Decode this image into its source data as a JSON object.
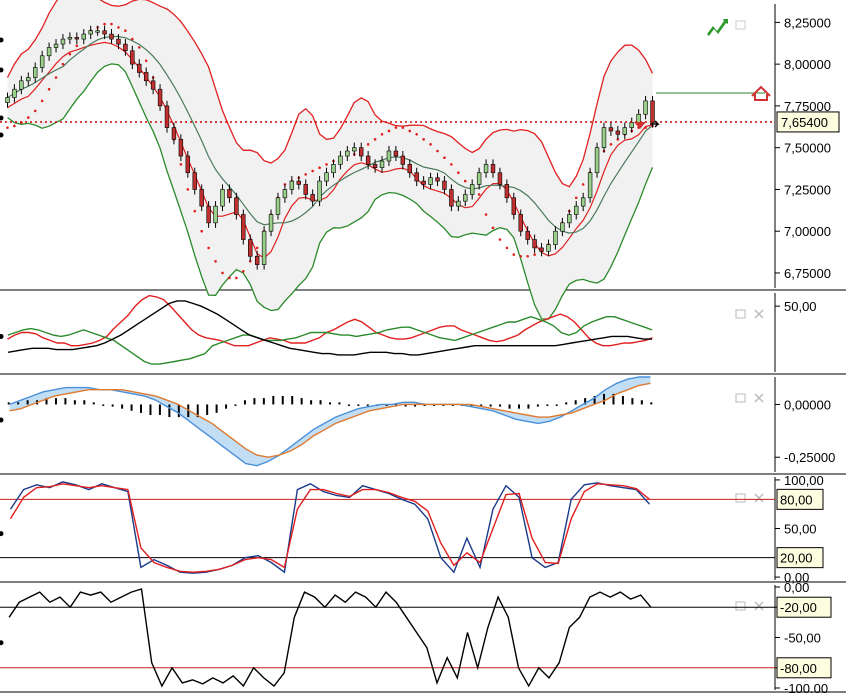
{
  "colors": {
    "bg": "#ffffff",
    "band_fill": "#f1f1f1",
    "band_line": "#e02020",
    "lower_line": "#2a8a2a",
    "ma_line": "#4a7a5a",
    "sar": "#e02020",
    "candle_up": "#9ad08a",
    "candle_down": "#c03030",
    "price_line": "#d00000",
    "black": "#000000",
    "macd_blue": "#4a90d9",
    "macd_orange": "#e07a30",
    "tag_bg": "#fdfde0"
  },
  "icons": {
    "trend_icon": "green-trend-arrow-icon",
    "trade_icon": "red-house-arrow-icon",
    "pane_restore_icon": "restore-icon",
    "pane_close_icon": "close-icon"
  },
  "chart_data": [
    {
      "id": "price",
      "type": "candlestick",
      "title": "",
      "y_ticks": [
        "8,25000",
        "8,00000",
        "7,75000",
        "7,50000",
        "7,25000",
        "7,00000",
        "6,75000"
      ],
      "y_tick_values": [
        8.25,
        8.0,
        7.75,
        7.5,
        7.25,
        7.0,
        6.75
      ],
      "ylim": [
        6.66,
        8.36
      ],
      "last_price_label": "7,65400",
      "last_price": 7.654,
      "overlays": [
        "bollinger-bands",
        "moving-averages",
        "parabolic-sar"
      ],
      "closes": [
        7.8,
        7.85,
        7.9,
        7.92,
        7.98,
        8.05,
        8.1,
        8.12,
        8.15,
        8.16,
        8.15,
        8.18,
        8.2,
        8.2,
        8.18,
        8.15,
        8.12,
        8.08,
        8.0,
        7.95,
        7.9,
        7.85,
        7.75,
        7.62,
        7.55,
        7.45,
        7.35,
        7.25,
        7.15,
        7.05,
        7.15,
        7.25,
        7.2,
        7.1,
        6.95,
        6.85,
        6.8,
        7.0,
        7.1,
        7.2,
        7.25,
        7.3,
        7.28,
        7.22,
        7.18,
        7.3,
        7.35,
        7.4,
        7.45,
        7.48,
        7.5,
        7.45,
        7.4,
        7.38,
        7.42,
        7.48,
        7.45,
        7.4,
        7.35,
        7.3,
        7.28,
        7.32,
        7.3,
        7.25,
        7.15,
        7.18,
        7.22,
        7.28,
        7.35,
        7.4,
        7.35,
        7.28,
        7.2,
        7.1,
        7.0,
        6.95,
        6.9,
        6.88,
        6.92,
        7.0,
        7.05,
        7.1,
        7.15,
        7.2,
        7.35,
        7.5,
        7.62,
        7.6,
        7.58,
        7.62,
        7.65,
        7.7,
        7.78,
        7.65
      ],
      "sar": [
        7.62,
        7.63,
        7.65,
        7.68,
        7.72,
        7.78,
        7.85,
        7.92,
        8.0,
        8.06,
        8.11,
        8.16,
        8.2,
        8.22,
        8.24,
        8.24,
        8.22,
        8.2,
        8.15,
        8.1,
        8.02,
        7.92,
        7.8,
        7.68,
        7.55,
        7.4,
        7.25,
        7.12,
        7.0,
        6.9,
        6.82,
        6.75,
        6.72,
        6.72,
        6.76,
        6.82,
        6.9,
        7.0,
        7.1,
        7.2,
        7.28,
        7.3,
        7.32,
        7.34,
        7.36,
        7.38,
        7.4,
        7.42,
        7.44,
        7.46,
        7.46,
        7.48,
        7.52,
        7.55,
        7.58,
        7.6,
        7.62,
        7.62,
        7.6,
        7.58,
        7.55,
        7.52,
        7.48,
        7.44,
        7.4,
        7.35,
        7.3,
        7.25,
        7.22,
        7.1,
        7.02,
        6.95,
        6.9,
        6.86,
        6.85,
        6.85,
        6.86,
        6.88,
        6.92,
        6.98,
        7.05,
        7.12,
        7.2,
        7.28,
        7.35,
        7.42,
        7.48,
        7.52,
        7.55,
        7.58,
        7.6,
        7.62,
        7.62,
        7.63
      ]
    },
    {
      "id": "adx",
      "type": "line",
      "title": "",
      "y_ticks": [
        "50,00"
      ],
      "y_tick_values": [
        50
      ],
      "ylim": [
        0,
        60
      ],
      "series": [
        {
          "color": "#e02020",
          "values": [
            25,
            28,
            30,
            30,
            29,
            26,
            24,
            22,
            22,
            20,
            20,
            21,
            22,
            24,
            27,
            33,
            38,
            43,
            50,
            55,
            58,
            57,
            55,
            50,
            44,
            38,
            32,
            28,
            26,
            25,
            24,
            22,
            20,
            20,
            20,
            22,
            24,
            26,
            25,
            24,
            22,
            22,
            22,
            24,
            26,
            30,
            32,
            35,
            38,
            40,
            38,
            34,
            30,
            28,
            26,
            25,
            25,
            26,
            28,
            30,
            32,
            34,
            35,
            35,
            32,
            30,
            28,
            26,
            24,
            23,
            24,
            26,
            28,
            32,
            35,
            38,
            40,
            42,
            44,
            42,
            38,
            32,
            26,
            22,
            20,
            20,
            21,
            22,
            22,
            23,
            24,
            26
          ]
        },
        {
          "color": "#2a8a2a",
          "values": [
            28,
            30,
            32,
            33,
            32,
            30,
            28,
            27,
            28,
            30,
            32,
            30,
            28,
            26,
            24,
            20,
            16,
            12,
            8,
            6,
            6,
            7,
            8,
            9,
            10,
            12,
            14,
            20,
            22,
            24,
            26,
            28,
            28,
            26,
            24,
            24,
            24,
            25,
            26,
            28,
            30,
            30,
            30,
            29,
            28,
            28,
            27,
            28,
            29,
            30,
            32,
            33,
            34,
            34,
            32,
            30,
            28,
            26,
            25,
            24,
            26,
            28,
            30,
            32,
            34,
            36,
            38,
            38,
            40,
            42,
            40,
            38,
            35,
            30,
            28,
            30,
            35,
            38,
            40,
            42,
            42,
            40,
            38,
            36,
            34,
            32
          ]
        },
        {
          "color": "#000000",
          "values": [
            15,
            16,
            17,
            18,
            18,
            18,
            17,
            17,
            17,
            18,
            19,
            20,
            22,
            25,
            28,
            32,
            36,
            40,
            44,
            48,
            52,
            54,
            54,
            52,
            50,
            47,
            44,
            40,
            36,
            32,
            28,
            26,
            24,
            22,
            20,
            18,
            17,
            16,
            15,
            14,
            14,
            13,
            13,
            13,
            14,
            15,
            15,
            15,
            14,
            14,
            13,
            13,
            14,
            15,
            16,
            17,
            18,
            19,
            20,
            20,
            20,
            20,
            20,
            20,
            20,
            20,
            20,
            20,
            20,
            21,
            22,
            23,
            24,
            25,
            26,
            27,
            27,
            27,
            26,
            25,
            25
          ]
        }
      ]
    },
    {
      "id": "macd",
      "type": "line",
      "title": "",
      "y_ticks": [
        "0,00000",
        "-0,25000"
      ],
      "y_tick_values": [
        0,
        -0.25
      ],
      "ylim": [
        -0.32,
        0.13
      ],
      "series": [
        {
          "color": "#4a90d9",
          "values": [
            0.0,
            0.02,
            0.04,
            0.06,
            0.07,
            0.08,
            0.08,
            0.08,
            0.07,
            0.07,
            0.06,
            0.05,
            0.04,
            0.02,
            -0.01,
            -0.04,
            -0.08,
            -0.12,
            -0.16,
            -0.2,
            -0.24,
            -0.28,
            -0.29,
            -0.27,
            -0.24,
            -0.2,
            -0.16,
            -0.12,
            -0.09,
            -0.06,
            -0.04,
            -0.02,
            -0.01,
            0.0,
            0.0,
            0.01,
            0.01,
            0.0,
            0.0,
            0.0,
            0.0,
            -0.01,
            -0.02,
            -0.03,
            -0.05,
            -0.07,
            -0.08,
            -0.09,
            -0.08,
            -0.06,
            -0.03,
            0.0,
            0.03,
            0.07,
            0.1,
            0.12,
            0.13,
            0.13
          ]
        },
        {
          "color": "#e07a30",
          "values": [
            -0.03,
            -0.02,
            0.0,
            0.02,
            0.04,
            0.05,
            0.06,
            0.07,
            0.07,
            0.07,
            0.07,
            0.06,
            0.05,
            0.04,
            0.02,
            0.0,
            -0.03,
            -0.06,
            -0.09,
            -0.13,
            -0.17,
            -0.21,
            -0.24,
            -0.25,
            -0.24,
            -0.22,
            -0.19,
            -0.15,
            -0.12,
            -0.09,
            -0.07,
            -0.05,
            -0.03,
            -0.02,
            -0.01,
            0.0,
            0.0,
            0.0,
            0.0,
            0.0,
            0.0,
            0.0,
            -0.01,
            -0.02,
            -0.03,
            -0.04,
            -0.05,
            -0.06,
            -0.06,
            -0.05,
            -0.04,
            -0.02,
            0.0,
            0.02,
            0.05,
            0.07,
            0.09,
            0.1
          ]
        },
        {
          "color": "#000000",
          "bars": true,
          "values": [
            0.01,
            0.01,
            0.02,
            0.02,
            0.03,
            0.03,
            0.03,
            0.02,
            0.02,
            0.01,
            0.0,
            -0.01,
            -0.02,
            -0.03,
            -0.04,
            -0.05,
            -0.05,
            -0.06,
            -0.06,
            -0.06,
            -0.06,
            -0.05,
            -0.04,
            -0.02,
            0.0,
            0.02,
            0.03,
            0.03,
            0.04,
            0.04,
            0.04,
            0.03,
            0.02,
            0.02,
            0.01,
            0.01,
            0.0,
            0.0,
            0.0,
            0.0,
            0.0,
            -0.01,
            -0.01,
            -0.01,
            0.0,
            0.0,
            0.0,
            0.0,
            0.0,
            0.0,
            0.0,
            -0.01,
            -0.01,
            -0.02,
            -0.02,
            -0.02,
            -0.01,
            0.0,
            0.0,
            0.01,
            0.02,
            0.03,
            0.04,
            0.05,
            0.05,
            0.04,
            0.03,
            0.02,
            0.01
          ]
        }
      ]
    },
    {
      "id": "stoch",
      "type": "line",
      "title": "",
      "y_ticks": [
        "100,00",
        "50,00",
        "0,00"
      ],
      "y_tick_values": [
        100,
        50,
        0
      ],
      "ylim": [
        -3,
        103
      ],
      "levels": [
        {
          "value": 80,
          "label": "80,00"
        },
        {
          "value": 20,
          "label": "20,00"
        }
      ],
      "series": [
        {
          "color": "#1a3a8a",
          "values": [
            70,
            90,
            95,
            92,
            98,
            95,
            90,
            96,
            92,
            88,
            10,
            18,
            12,
            5,
            4,
            5,
            8,
            12,
            20,
            22,
            15,
            5,
            90,
            96,
            88,
            84,
            82,
            94,
            90,
            86,
            80,
            75,
            60,
            20,
            5,
            40,
            10,
            70,
            94,
            82,
            20,
            10,
            15,
            80,
            95,
            97,
            94,
            92,
            90,
            75
          ]
        },
        {
          "color": "#e02020",
          "values": [
            60,
            82,
            92,
            93,
            96,
            94,
            92,
            94,
            92,
            90,
            30,
            15,
            10,
            6,
            5,
            6,
            8,
            12,
            18,
            20,
            18,
            10,
            70,
            90,
            90,
            86,
            83,
            90,
            90,
            87,
            82,
            78,
            68,
            35,
            12,
            25,
            15,
            50,
            85,
            86,
            40,
            15,
            14,
            60,
            88,
            96,
            95,
            94,
            91,
            80
          ]
        }
      ]
    },
    {
      "id": "williams",
      "type": "line",
      "title": "",
      "y_ticks": [
        "0,00",
        "-20,00",
        "-50,00",
        "-80,00",
        "-100,00"
      ],
      "y_tick_values": [
        0,
        -20,
        -50,
        -80,
        -100
      ],
      "ylim": [
        -102,
        2
      ],
      "levels": [
        {
          "value": -20,
          "label": "-20,00"
        },
        {
          "value": -80,
          "label": "-80,00"
        }
      ],
      "series": [
        {
          "color": "#000000",
          "values": [
            -30,
            -15,
            -10,
            -5,
            -15,
            -10,
            -20,
            -5,
            -8,
            -5,
            -15,
            -10,
            -5,
            -2,
            -75,
            -98,
            -80,
            -95,
            -92,
            -96,
            -90,
            -95,
            -88,
            -98,
            -80,
            -90,
            -98,
            -85,
            -30,
            -5,
            -10,
            -20,
            -8,
            -15,
            -5,
            -10,
            -20,
            -5,
            -15,
            -30,
            -45,
            -60,
            -95,
            -70,
            -90,
            -45,
            -80,
            -40,
            -10,
            -30,
            -80,
            -98,
            -80,
            -90,
            -75,
            -40,
            -30,
            -10,
            -5,
            -10,
            -5,
            -12,
            -8,
            -20
          ]
        }
      ]
    }
  ]
}
